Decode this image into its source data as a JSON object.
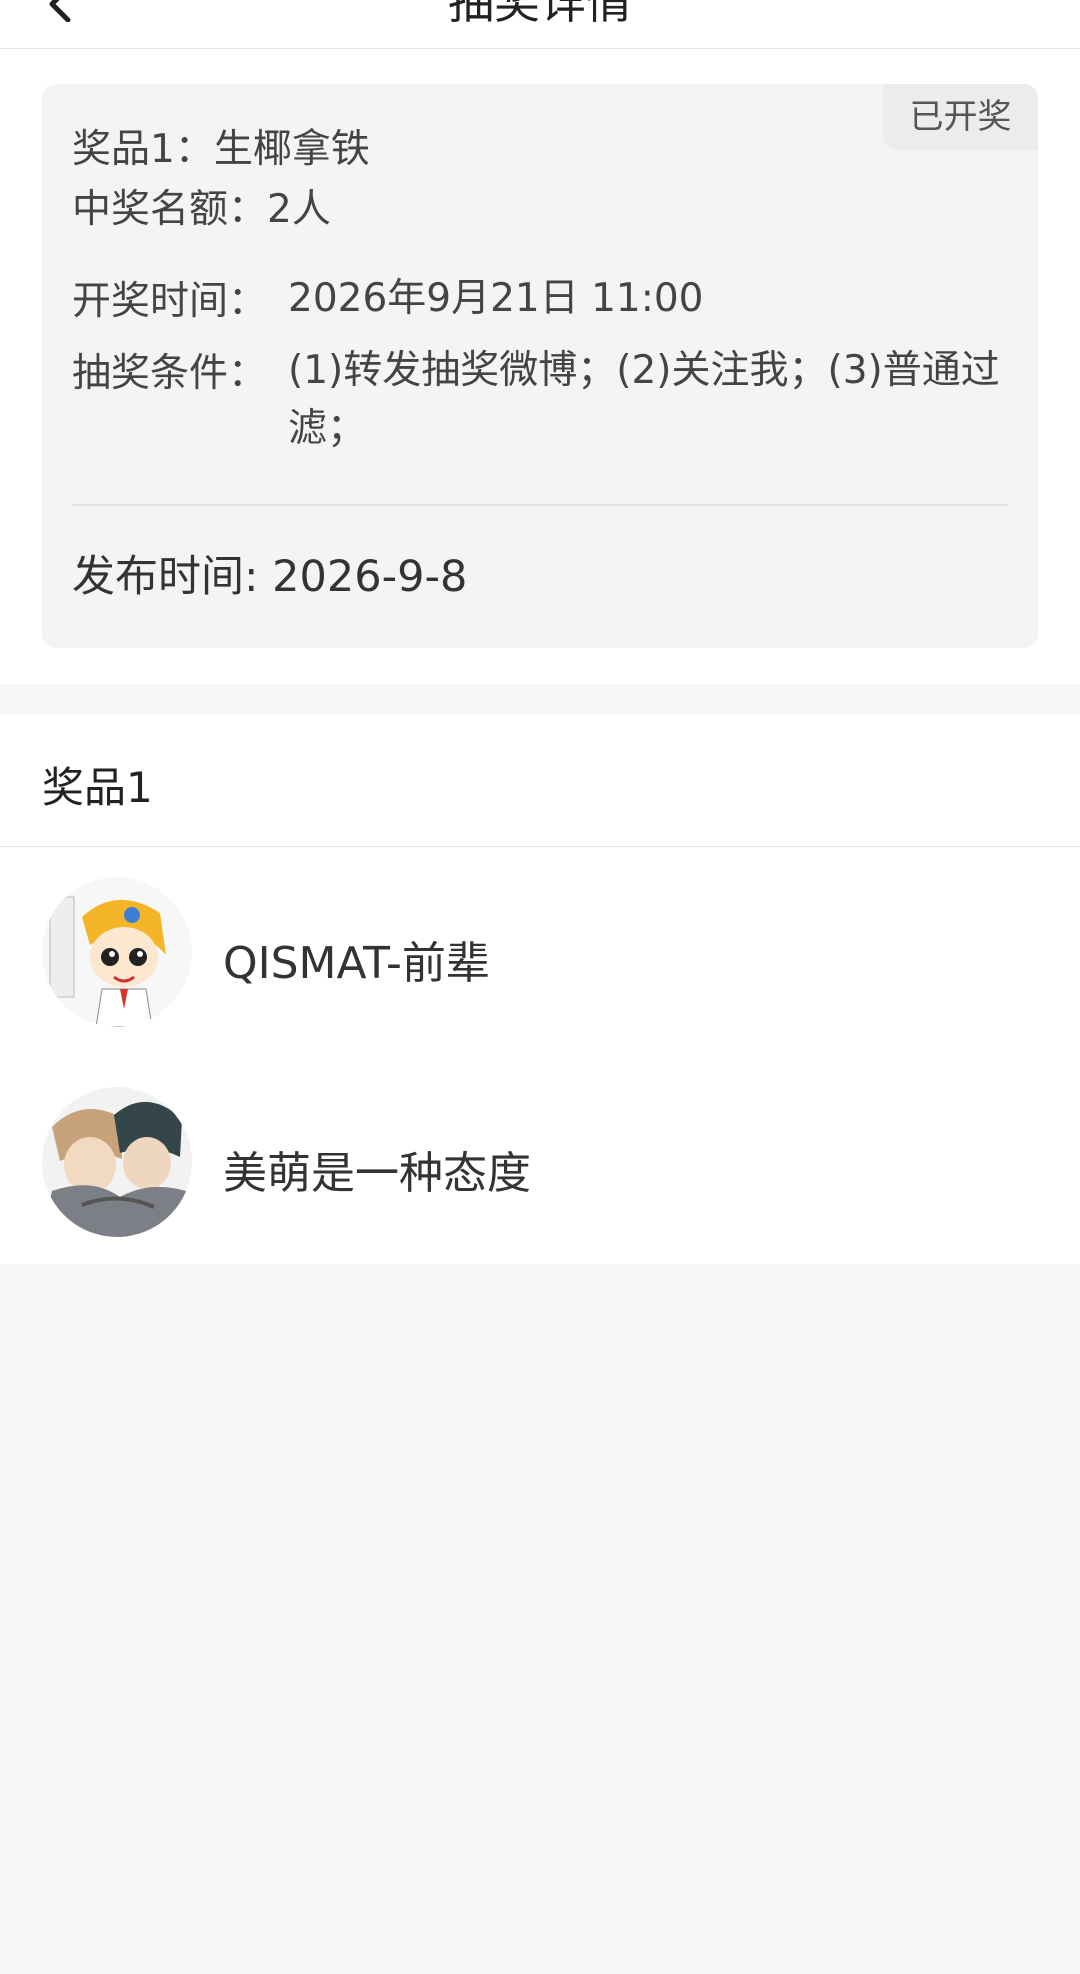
{
  "header": {
    "title": "抽奖详情",
    "back_icon": "chevron-left-icon"
  },
  "card": {
    "status_badge": "已开奖",
    "prize_line": "奖品1：生椰拿铁",
    "winners_line": "中奖名额：2人",
    "draw_time_label": "开奖时间：",
    "draw_time_value": "2026年9月21日 11:00",
    "conditions_label": "抽奖条件：",
    "conditions_value": "(1)转发抽奖微博；(2)关注我；(3)普通过滤；",
    "publish_line": "发布时间: 2026-9-8"
  },
  "winners_section": {
    "title": "奖品1",
    "winners": [
      {
        "name": "QISMAT-前辈"
      },
      {
        "name": "美萌是一种态度"
      }
    ]
  }
}
